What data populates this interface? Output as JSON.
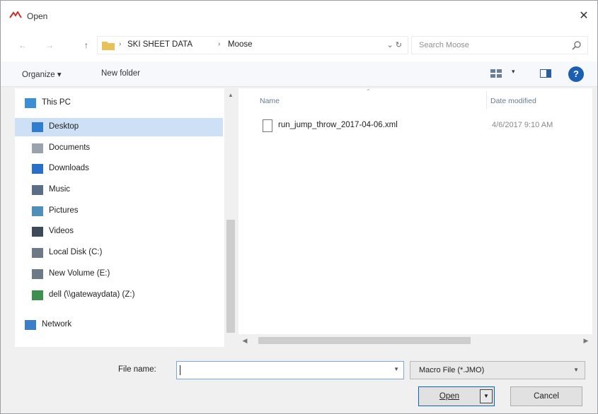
{
  "window": {
    "title": "Open",
    "close_symbol": "✕",
    "accent_color": "#c8302b"
  },
  "address": {
    "back_symbol": "←",
    "forward_symbol": "→",
    "up_symbol": "↑",
    "crumbs": [
      "SKI SHEET DATA",
      "Moose"
    ],
    "separator": "›",
    "tools": "⌄  ↻",
    "search_placeholder": "Search Moose"
  },
  "command_bar": {
    "organize_label": "Organize ▾",
    "new_folder_label": "New folder",
    "help_symbol": "?"
  },
  "nav_pane": {
    "items": [
      {
        "label": "This PC",
        "icon": "computer-icon",
        "selected": false
      },
      {
        "label": "Desktop",
        "icon": "desktop-icon",
        "selected": true
      },
      {
        "label": "Documents",
        "icon": "documents-icon",
        "selected": false
      },
      {
        "label": "Downloads",
        "icon": "downloads-icon",
        "selected": false
      },
      {
        "label": "Music",
        "icon": "music-icon",
        "selected": false
      },
      {
        "label": "Pictures",
        "icon": "pictures-icon",
        "selected": false
      },
      {
        "label": "Videos",
        "icon": "videos-icon",
        "selected": false
      },
      {
        "label": "Local Disk (C:)",
        "icon": "drive-icon",
        "selected": false
      },
      {
        "label": "New Volume (E:)",
        "icon": "drive-icon",
        "selected": false
      },
      {
        "label": "dell (\\\\gatewaydata) (Z:)",
        "icon": "network-drive-icon",
        "selected": false
      },
      {
        "label": "Network",
        "icon": "network-icon",
        "selected": false
      }
    ]
  },
  "file_list": {
    "columns": {
      "name": "Name",
      "date": "Date modified"
    },
    "files": [
      {
        "name": "run_jump_throw_2017-04-06.xml",
        "date": "4/6/2017 9:10 AM"
      }
    ]
  },
  "footer": {
    "file_name_label": "File name:",
    "file_name_value": "",
    "file_type_value": "Macro File (*.JMO)",
    "open_label": "Open",
    "cancel_label": "Cancel"
  }
}
